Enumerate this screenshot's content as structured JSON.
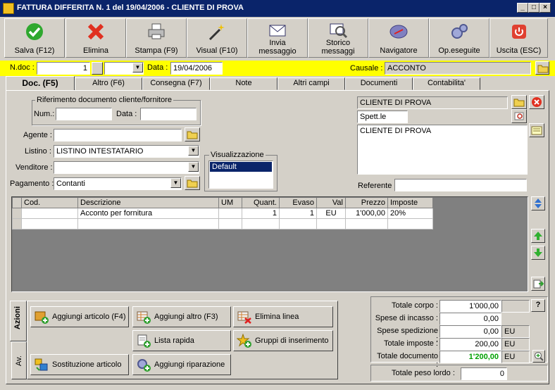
{
  "window": {
    "title": "FATTURA DIFFERITA N. 1  del 19/04/2006 - CLIENTE DI PROVA",
    "btn_min": "_",
    "btn_max": "□",
    "btn_close": "×"
  },
  "toolbar": {
    "save": "Salva (F12)",
    "delete": "Elimina",
    "print": "Stampa (F9)",
    "visual": "Visual (F10)",
    "send_line1": "Invia",
    "send_line2": "messaggio",
    "history_line1": "Storico",
    "history_line2": "messaggi",
    "navigator": "Navigatore",
    "ops": "Op.eseguite",
    "exit": "Uscita (ESC)"
  },
  "header": {
    "ndoc_label": "N.doc :",
    "ndoc_value": "",
    "ndoc_number": "1",
    "data_label": "Data :",
    "data_value": "19/04/2006",
    "causale_label": "Causale :",
    "causale_value": "ACCONTO"
  },
  "tabs": [
    "Doc. (F5)",
    "Altro (F6)",
    "Consegna (F7)",
    "Note",
    "Altri campi",
    "Documenti",
    "Contabilita'"
  ],
  "doc": {
    "rif_group": "Riferimento documento cliente/fornitore",
    "num_label": "Num.:",
    "num_value": "",
    "data_label": "Data :",
    "data_value": "",
    "agente_label": "Agente :",
    "agente_value": "",
    "listino_label": "Listino :",
    "listino_value": "LISTINO INTESTATARIO",
    "venditore_label": "Venditore :",
    "venditore_value": "",
    "pagamento_label": "Pagamento :",
    "pagamento_value": "Contanti",
    "visual_group": "Visualizzazione",
    "visual_options": [
      "Default"
    ],
    "cliente_name": "CLIENTE DI PROVA",
    "cliente_title": "Spett.le",
    "cliente_address": "CLIENTE DI PROVA",
    "referente_label": "Referente",
    "referente_value": ""
  },
  "grid": {
    "columns": [
      "Cod.",
      "Descrizione",
      "UM",
      "Quant.",
      "Evaso",
      "Val",
      "Prezzo",
      "Imposte"
    ],
    "rows": [
      [
        "",
        "Acconto per fornitura",
        "",
        "1",
        "1",
        "EU",
        "1'000,00",
        "20%"
      ],
      [
        "",
        "",
        "",
        "",
        "",
        "",
        "",
        ""
      ]
    ]
  },
  "azioni": {
    "tab_azioni": "Azioni",
    "tab_av": "Av.",
    "add_article": "Aggiungi articolo (F4)",
    "add_other": "Aggiungi altro (F3)",
    "delete_line": "Elimina linea",
    "quick_list": "Lista rapida",
    "insert_groups": "Gruppi di inserimento",
    "replace_article": "Sostituzione articolo",
    "add_repair": "Aggiungi riparazione"
  },
  "totals": {
    "corpo_label": "Totale corpo :",
    "corpo_value": "1'000,00",
    "incasso_label": "Spese di incasso :",
    "incasso_value": "0,00",
    "spedizione_label": "Spese spedizione :",
    "spedizione_value": "0,00",
    "spedizione_cur": "EU",
    "imposte_label": "Totale imposte :",
    "imposte_value": "200,00",
    "imposte_cur": "EU",
    "documento_label": "Totale documento :",
    "documento_value": "1'200,00",
    "documento_cur": "EU",
    "help": "?",
    "peso_label": "Totale peso lordo :",
    "peso_value": "0"
  },
  "colors": {
    "title_bg": "#0a246a",
    "yellow_bar": "#ffff00",
    "total_green": "#00a000"
  }
}
